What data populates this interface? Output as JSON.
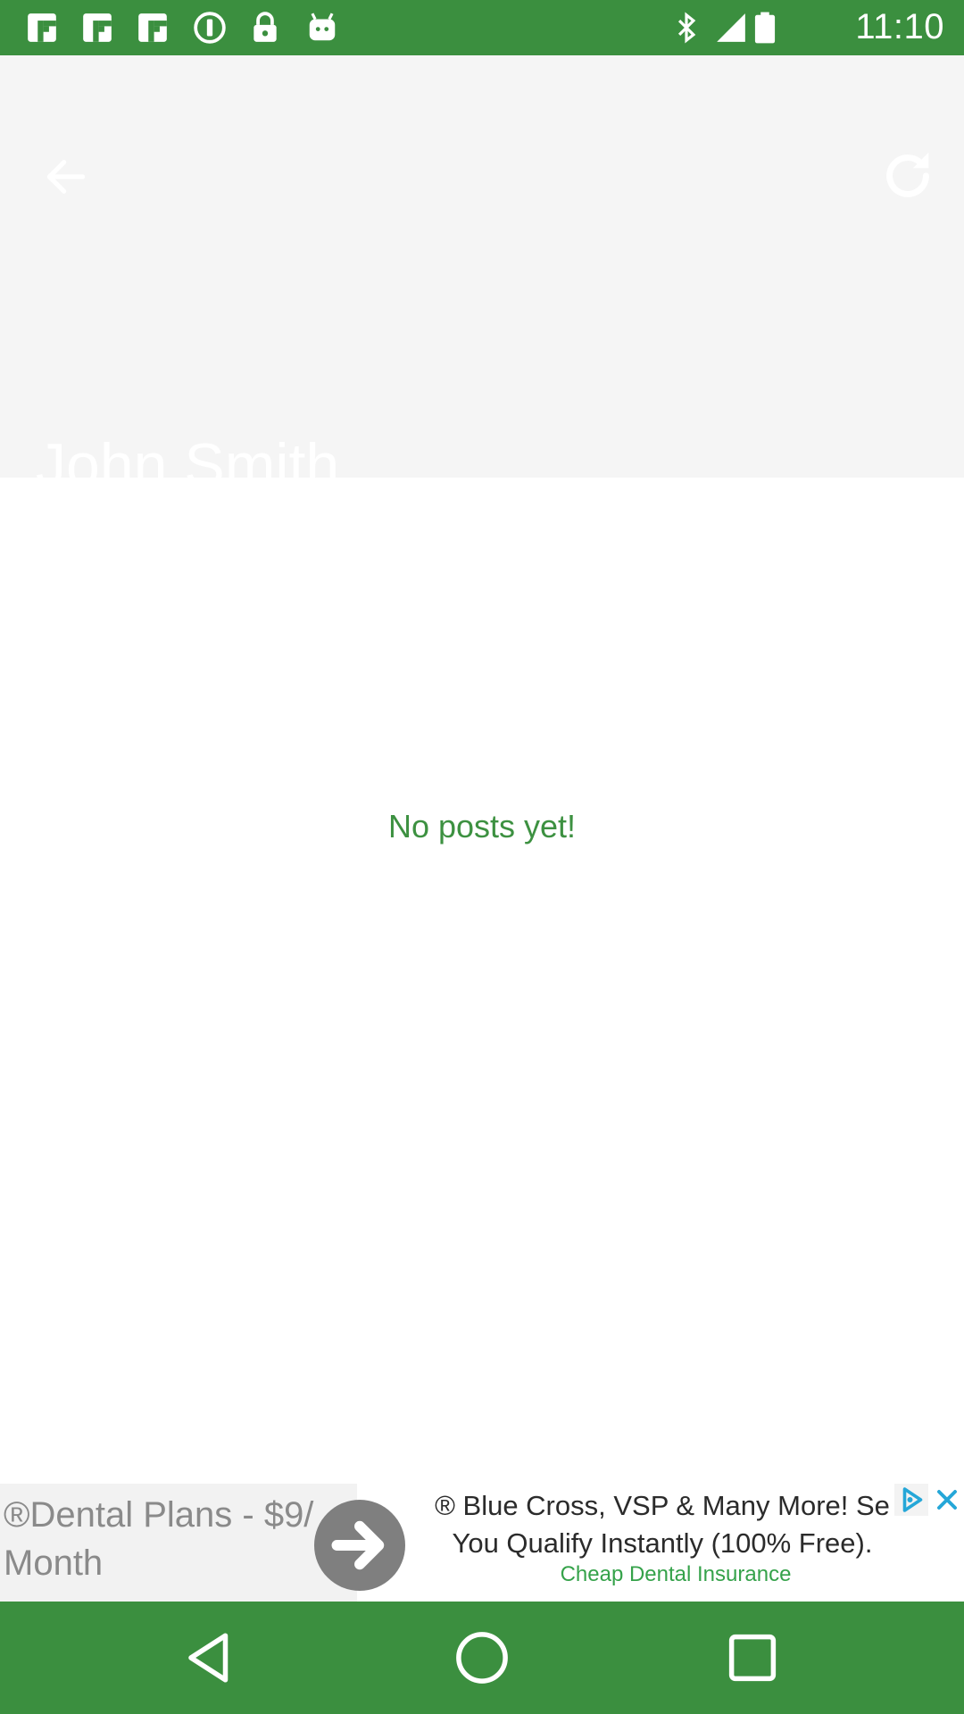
{
  "status_bar": {
    "time": "11:10",
    "icons_left": [
      "flipboard-icon",
      "flipboard-icon",
      "flipboard-icon",
      "info-icon",
      "lock-icon",
      "android-icon"
    ],
    "icons_right": [
      "bluetooth-icon",
      "signal-icon",
      "battery-icon"
    ],
    "background": "#3b8f3f"
  },
  "toolbar": {
    "back_icon": "back-arrow-icon",
    "refresh_icon": "refresh-icon",
    "profile_name": "John Smith",
    "background": "#f5f5f5"
  },
  "main": {
    "empty_message": "No posts yet!",
    "accent_color": "#3d9141"
  },
  "ad": {
    "title": "®Dental Plans - $9/ Month",
    "body_line1": "® Blue Cross, VSP & Many More! Se",
    "body_line2": "You Qualify Instantly (100% Free).",
    "link": "Cheap Dental Insurance",
    "arrow_icon": "arrow-right-icon",
    "choices_icon": "adchoices-icon",
    "close_icon": "close-icon"
  },
  "nav_bar": {
    "back": "nav-back-icon",
    "home": "nav-home-icon",
    "recents": "nav-recents-icon",
    "background": "#3b8f3f"
  }
}
